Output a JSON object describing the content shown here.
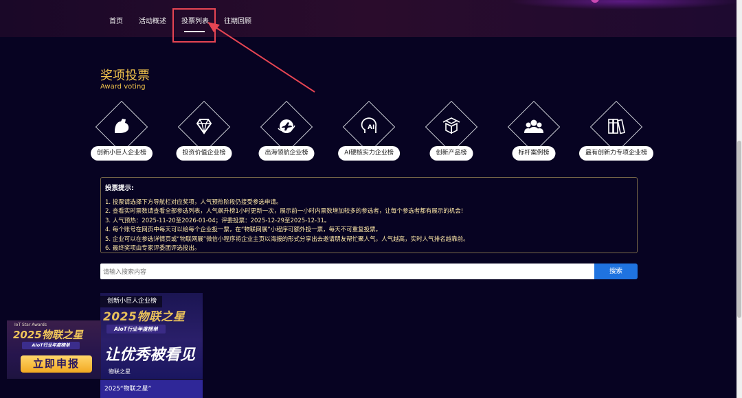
{
  "nav": {
    "items": [
      "首页",
      "活动概述",
      "投票列表",
      "往期回顾"
    ],
    "active_index": 2
  },
  "section": {
    "title": "奖项投票",
    "subtitle": "Award voting"
  },
  "categories": [
    {
      "label": "创新小巨人企业榜",
      "icon": "flexed-arm-icon"
    },
    {
      "label": "投资价值企业榜",
      "icon": "diamond-icon"
    },
    {
      "label": "出海领航企业榜",
      "icon": "globe-plane-icon"
    },
    {
      "label": "AI硬核实力企业榜",
      "icon": "ai-head-icon"
    },
    {
      "label": "创新产品榜",
      "icon": "boxes-icon"
    },
    {
      "label": "标杆案例榜",
      "icon": "people-group-icon"
    },
    {
      "label": "最有创新力专项企业榜",
      "icon": "books-icon"
    }
  ],
  "tips": {
    "title": "投票提示:",
    "lines": [
      "1. 投票请选择下方导航栏对应奖项，人气预热阶段仍接受参选申请。",
      "2. 查看实时票数请查看全部参选列表，人气飙升榜1小时更新一次，展示前一小时内票数增加较多的参选者，让每个参选者都有展示的机会!",
      "3. 人气预热：2025-11-20至2026-01-04；评委投票：2025-12-29至2025-12-31。",
      "4. 每个账号在网页中每天可以给每个企业投一票，在“物联网展”小程序可额外投一票，每天不可重复投票。",
      "5. 企业可以在参选详情页或“物联网展”微信小程序将企业主页以海报的形式分享出去邀请朋友帮忙聚人气，人气越高，实时人气排名越靠前。",
      "6. 最终奖项由专家评委团评选投出。"
    ]
  },
  "search": {
    "placeholder": "请输入搜索内容",
    "button_label": "搜索"
  },
  "card": {
    "tag": "创新小巨人企业榜",
    "poster_title": "2025物联之星",
    "poster_subtitle": "AIoT行业年度榜单",
    "poster_slogan": "让优秀被看见",
    "poster_brand": "物联之星",
    "caption": "2025“物联之星”"
  },
  "promo": {
    "label": "IoT Star Awards",
    "title": "2025物联之星",
    "subtitle": "AIoT行业年度榜单",
    "button_label": "立即申报"
  },
  "colors": {
    "background": "#070322",
    "accent_gold": "#f0c24b",
    "search_button": "#1f73e0",
    "annotation_red": "#e64553"
  }
}
